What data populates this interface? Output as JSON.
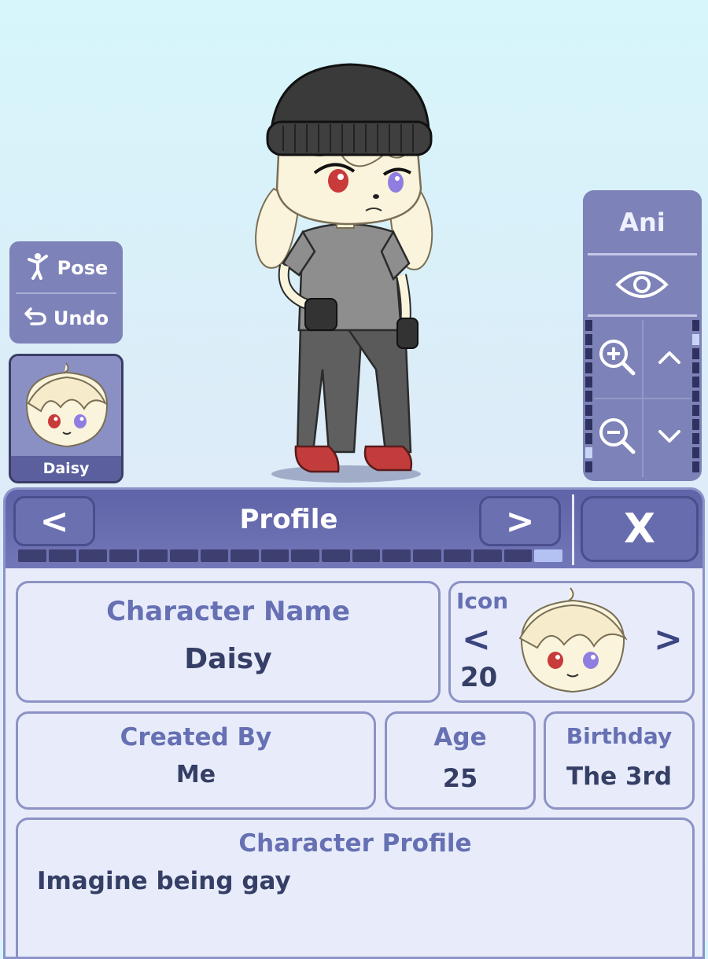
{
  "left_panel": {
    "pose_label": "Pose",
    "undo_label": "Undo"
  },
  "avatar_card": {
    "name": "Daisy"
  },
  "right_panel": {
    "title": "Ani"
  },
  "profile": {
    "header_title": "Profile",
    "prev_symbol": "<",
    "next_symbol": ">",
    "close_symbol": "X",
    "progress": {
      "segments": 18,
      "active_index": 17
    },
    "character_name_label": "Character Name",
    "character_name": "Daisy",
    "icon_label": "Icon",
    "icon_number": "20",
    "icon_prev": "<",
    "icon_next": ">",
    "created_by_label": "Created By",
    "created_by": "Me",
    "age_label": "Age",
    "age": "25",
    "birthday_label": "Birthday",
    "birthday": "The 3rd",
    "character_profile_label": "Character Profile",
    "character_profile_text": "Imagine being gay"
  },
  "colors": {
    "panel": "#7d82b8",
    "header": "#6569ab",
    "label_text": "#6670b3",
    "value_text": "#353f66"
  }
}
